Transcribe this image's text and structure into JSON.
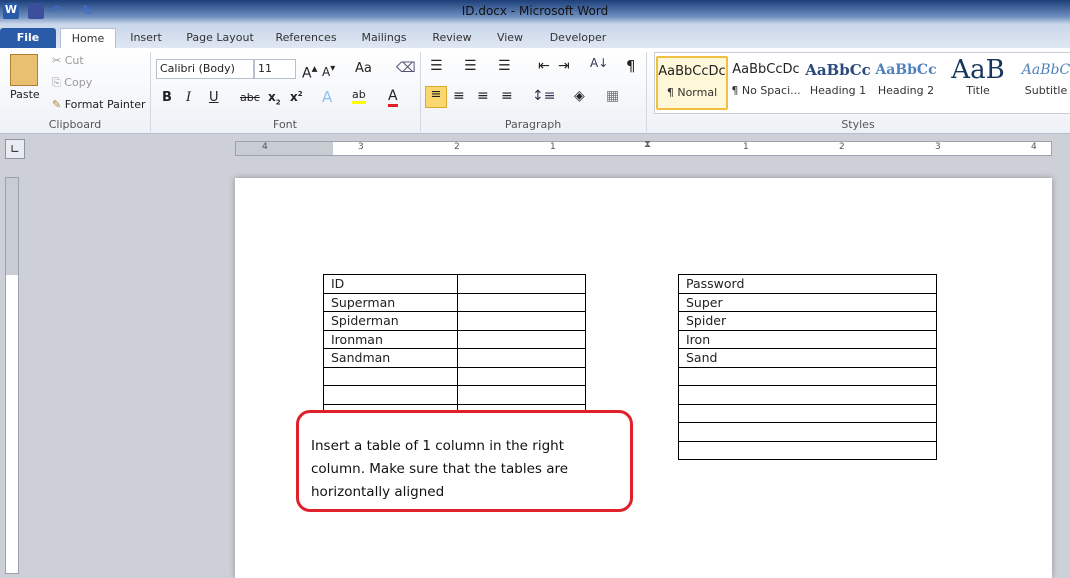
{
  "window": {
    "title": "ID.docx - Microsoft Word"
  },
  "tabs": [
    "File",
    "Home",
    "Insert",
    "Page Layout",
    "References",
    "Mailings",
    "Review",
    "View",
    "Developer"
  ],
  "clipboard": {
    "paste": "Paste",
    "cut": "Cut",
    "copy": "Copy",
    "format_painter": "Format Painter",
    "label": "Clipboard"
  },
  "font": {
    "name": "Calibri (Body)",
    "size": "11",
    "label": "Font",
    "change_case": "Aa"
  },
  "paragraph": {
    "label": "Paragraph"
  },
  "styles": {
    "label": "Styles",
    "items": [
      {
        "preview": "AaBbCcDc",
        "name": "¶ Normal"
      },
      {
        "preview": "AaBbCcDc",
        "name": "¶ No Spaci..."
      },
      {
        "preview": "AaBbCc",
        "name": "Heading 1"
      },
      {
        "preview": "AaBbCc",
        "name": "Heading 2"
      },
      {
        "preview": "AaB",
        "name": "Title"
      },
      {
        "preview": "AaBbC",
        "name": "Subtitle"
      }
    ]
  },
  "ruler": {
    "labels": [
      "4",
      "3",
      "2",
      "1",
      "1",
      "2",
      "3",
      "4"
    ]
  },
  "left_table": {
    "rows": [
      [
        "ID",
        ""
      ],
      [
        "Superman",
        ""
      ],
      [
        "Spiderman",
        ""
      ],
      [
        "Ironman",
        ""
      ],
      [
        "Sandman",
        ""
      ],
      [
        "",
        ""
      ],
      [
        "",
        ""
      ],
      [
        "",
        ""
      ],
      [
        "",
        ""
      ],
      [
        "",
        ""
      ]
    ]
  },
  "right_table": {
    "rows": [
      "Password",
      "Super",
      "Spider",
      "Iron",
      "Sand",
      "",
      "",
      "",
      "",
      ""
    ]
  },
  "callout": {
    "text": "Insert a table of 1 column in the right column. Make sure that the tables are horizontally aligned",
    "border_color": "#e0202a"
  }
}
